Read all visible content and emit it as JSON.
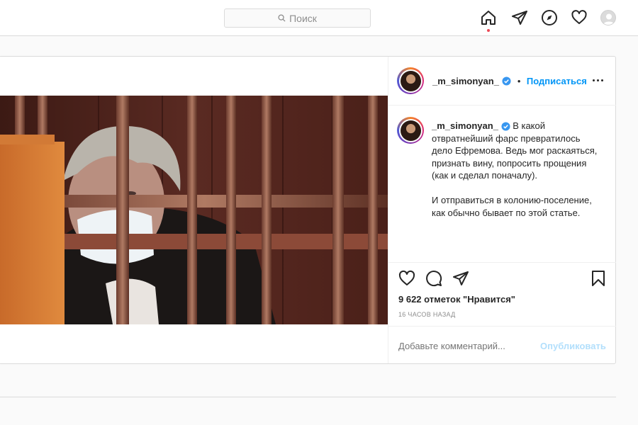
{
  "search": {
    "placeholder": "Поиск"
  },
  "nav": {
    "icons": [
      "home-icon",
      "direct-icon",
      "explore-icon",
      "activity-heart-icon",
      "profile-avatar"
    ]
  },
  "post": {
    "username": "_m_simonyan_",
    "follow_label": "Подписаться",
    "separator": "•",
    "caption_paragraphs": [
      "В какой отвратнейший фарс превратилось дело Ефремова. Ведь мог раскаяться, признать вину, попросить прощения (как и сделал поначалу).",
      "И отправиться в колонию-поселение, как обычно бывает по этой статье."
    ],
    "likes": "9 622 отметок \"Нравится\"",
    "time_ago": "16 ЧАСОВ НАЗАД",
    "comment_placeholder": "Добавьте комментарий...",
    "publish_label": "Опубликовать"
  },
  "colors": {
    "accent_blue": "#0095f6",
    "publish_disabled": "#b2dffc",
    "notification_dot": "#ed4956"
  }
}
